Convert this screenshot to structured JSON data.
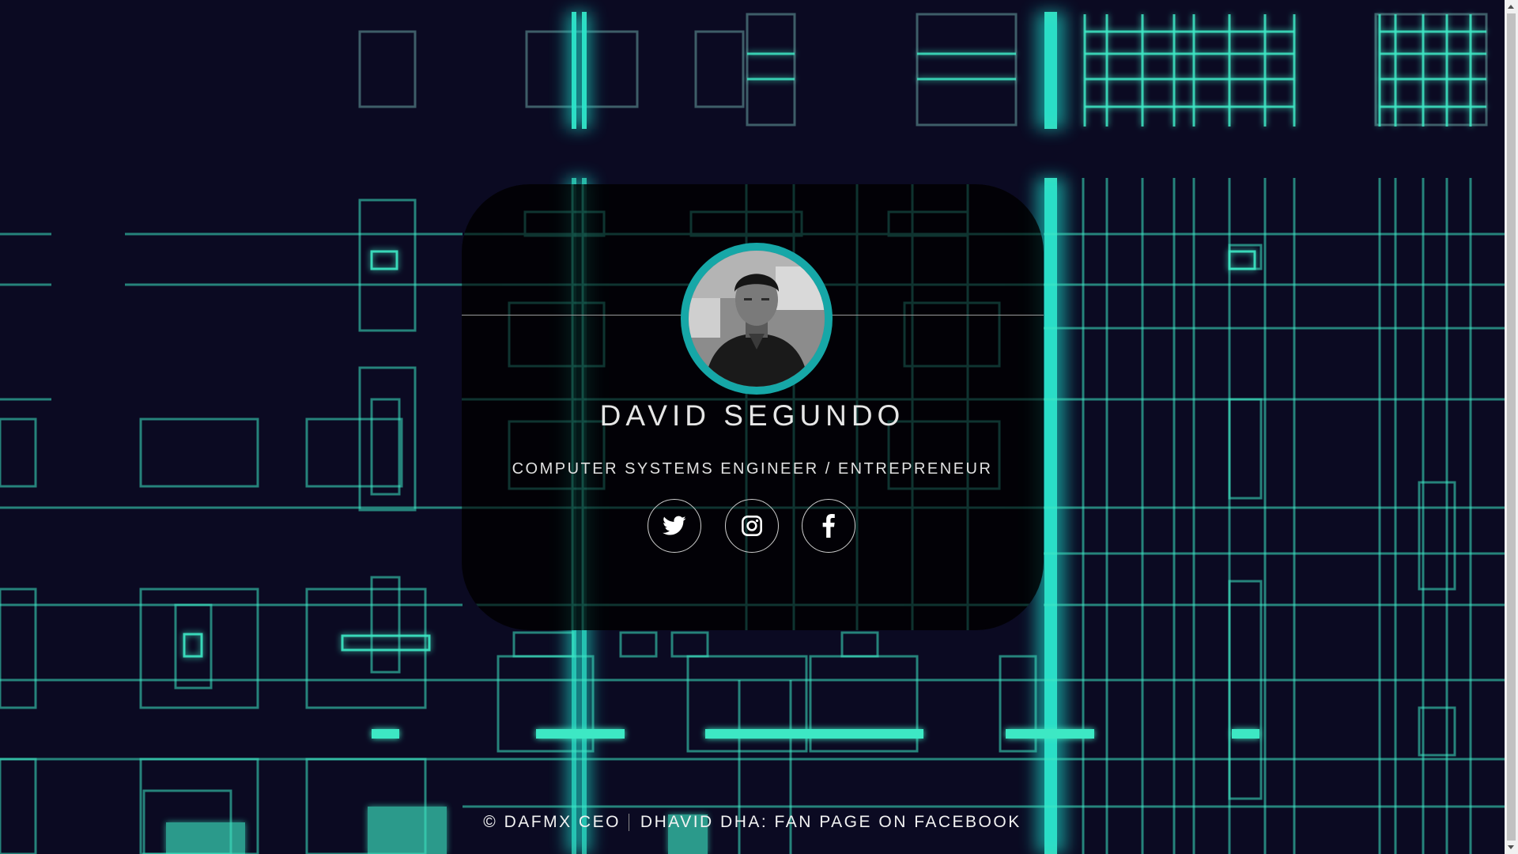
{
  "profile": {
    "name": "DAVID SEGUNDO",
    "tagline": "COMPUTER SYSTEMS ENGINEER / ENTREPRENEUR"
  },
  "social": [
    {
      "icon": "twitter-icon"
    },
    {
      "icon": "instagram-icon"
    },
    {
      "icon": "facebook-icon"
    }
  ],
  "footer": {
    "copyright": "© DAFMX CEO",
    "link": "DHAVID DHA: FAN PAGE ON FACEBOOK"
  },
  "colors": {
    "accent": "#16a7a7",
    "circuit": "#3ee8c4",
    "background": "#0b0a22"
  }
}
